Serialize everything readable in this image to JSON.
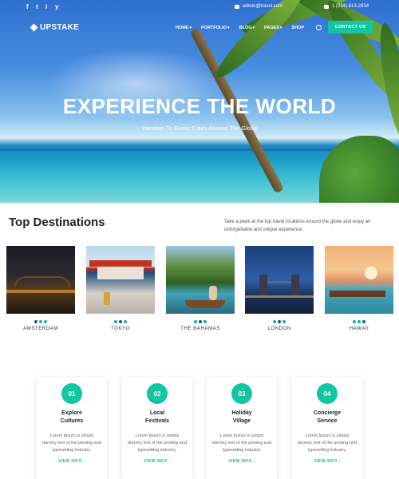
{
  "topbar": {
    "social": [
      "f",
      "t",
      "i",
      "y"
    ],
    "email": "admin@travel.com",
    "phone": "1 (234) 613-2834"
  },
  "header": {
    "logo": "UPSTAKE",
    "nav": [
      {
        "label": "HOME",
        "caret": "▾"
      },
      {
        "label": "PORTFOLIO",
        "caret": "▾"
      },
      {
        "label": "BLOG",
        "caret": "▾"
      },
      {
        "label": "PAGES",
        "caret": "▾"
      },
      {
        "label": "SHOP",
        "caret": ""
      }
    ],
    "cta": "CONTACT US"
  },
  "hero": {
    "title": "EXPERIENCE THE WORLD",
    "subtitle": "Vacation To Exotic Cities Around The Globe"
  },
  "destinations": {
    "title": "Top Destinations",
    "description": "Take a peek at the top travel locations around the globe and enjoy an unforgettable and unique experience.",
    "items": [
      {
        "name": "AMSTERDAM"
      },
      {
        "name": "TOKYO"
      },
      {
        "name": "THE BAHAMAS"
      },
      {
        "name": "LONDON"
      },
      {
        "name": "HAWAII"
      }
    ]
  },
  "features": [
    {
      "num": "01",
      "title": "Explore\nCultures",
      "text": "Lorem Ipsum is simply dummy text of the printing and typesetting industry.",
      "link": "VIEW INFO ›"
    },
    {
      "num": "02",
      "title": "Local\nFestivals",
      "text": "Lorem Ipsum is simply dummy text of the printing and typesetting industry.",
      "link": "VIEW INFO ›"
    },
    {
      "num": "03",
      "title": "Holiday\nVillage",
      "text": "Lorem Ipsum is simply dummy text of the printing and typesetting industry.",
      "link": "VIEW INFO ›"
    },
    {
      "num": "04",
      "title": "Concierge\nService",
      "text": "Lorem Ipsum is simply dummy text of the printing and typesetting industry.",
      "link": "VIEW INFO ›"
    }
  ],
  "colors": {
    "accent": "#12c6a3",
    "dot_dark": "#0d6a5a"
  }
}
